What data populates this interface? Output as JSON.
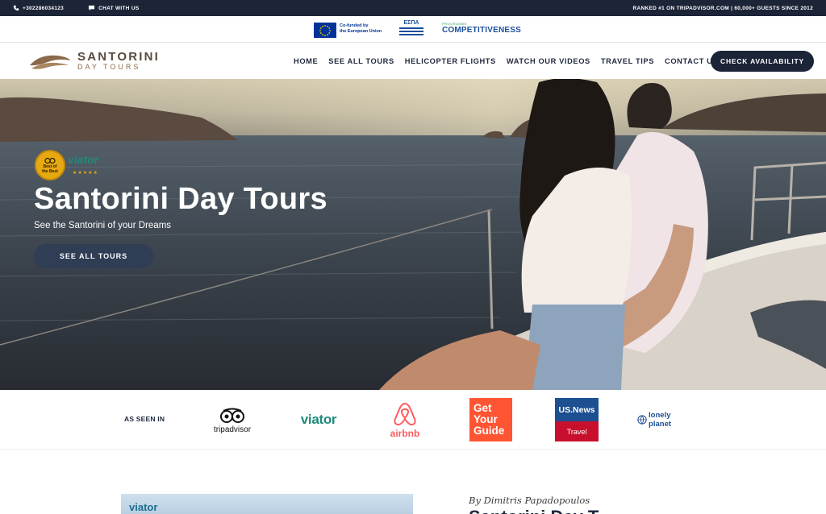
{
  "topbar": {
    "phone": "+302286034123",
    "chat": "CHAT WITH US",
    "ranking": "RANKED #1 ON TRIPADVISOR.COM | 60,000+ GUESTS SINCE 2012"
  },
  "funding": {
    "eu_text": "Co-funded by\nthe European Union",
    "espa": "ΕΣΠΑ",
    "comp_top": "PROGRAMME",
    "comp_main": "COMPETITIVENESS"
  },
  "header": {
    "logo_main": "SANTORINI",
    "logo_sub": "DAY TOURS",
    "nav": [
      "HOME",
      "SEE ALL TOURS",
      "HELICOPTER FLIGHTS",
      "WATCH OUR VIDEOS",
      "TRAVEL TIPS",
      "CONTACT US"
    ],
    "cta": "CHECK AVAILABILITY"
  },
  "hero": {
    "badge_lines": [
      "Best of",
      "the Best"
    ],
    "badge_brand": "viator",
    "badge_stars": "★★★★★",
    "title": "Santorini Day Tours",
    "subtitle": "See the Santorini of your Dreams",
    "button": "SEE ALL TOURS"
  },
  "seen_in": {
    "label": "AS SEEN IN",
    "tripadvisor": "tripadvisor",
    "viator": "viator",
    "airbnb": "airbnb",
    "getyourguide": [
      "Get",
      "Your",
      "Guide"
    ],
    "usnews_top": "US.News",
    "usnews_bottom": "Travel",
    "lonelyplanet": "lonely planet"
  },
  "article": {
    "image_brand": "viator",
    "byline": "By Dimitris Papadopoulos",
    "title": "Santorini Day T"
  },
  "colors": {
    "navy": "#1c2438",
    "button": "#2f3d55",
    "accent_brown": "#5a4a3a"
  }
}
